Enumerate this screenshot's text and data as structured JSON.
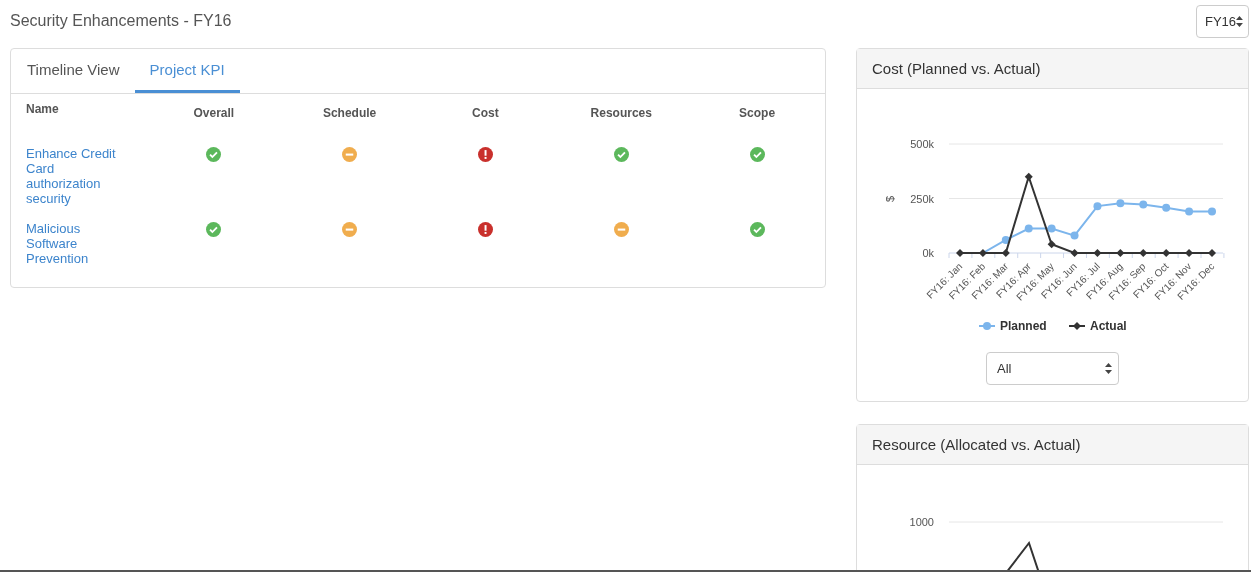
{
  "page_title": "Security Enhancements - FY16",
  "year_select": {
    "value": "FY16"
  },
  "tabs": [
    {
      "label": "Timeline View",
      "selected": false
    },
    {
      "label": "Project KPI",
      "selected": true
    }
  ],
  "kpi_table": {
    "columns": [
      "Name",
      "Overall",
      "Schedule",
      "Cost",
      "Resources",
      "Scope"
    ],
    "rows": [
      {
        "name": "Enhance Credit Card authorization security",
        "statuses": [
          {
            "kind": "ok"
          },
          {
            "kind": "warning"
          },
          {
            "kind": "error"
          },
          {
            "kind": "ok"
          },
          {
            "kind": "ok"
          }
        ]
      },
      {
        "name": "Malicious Software Prevention",
        "statuses": [
          {
            "kind": "ok"
          },
          {
            "kind": "warning"
          },
          {
            "kind": "error"
          },
          {
            "kind": "warning"
          },
          {
            "kind": "ok"
          }
        ]
      }
    ]
  },
  "cost_panel": {
    "title": "Cost (Planned vs. Actual)",
    "chart_data": {
      "type": "line",
      "ylabel": "$",
      "categories": [
        "FY16: Jan",
        "FY16: Feb",
        "FY16: Mar",
        "FY16: Apr",
        "FY16: May",
        "FY16: Jun",
        "FY16: Jul",
        "FY16: Aug",
        "FY16: Sep",
        "FY16: Oct",
        "FY16: Nov",
        "FY16: Dec"
      ],
      "legend": true,
      "series": [
        {
          "name": "Planned",
          "color": "#7cb5ec",
          "marker": "circle",
          "values": [
            0,
            0,
            60000,
            112000,
            112000,
            80000,
            215000,
            228000,
            222000,
            208000,
            190000,
            190000
          ]
        },
        {
          "name": "Actual",
          "color": "#333333",
          "marker": "diamond",
          "values": [
            0,
            0,
            0,
            350000,
            40000,
            0,
            0,
            0,
            0,
            0,
            0,
            0
          ]
        }
      ],
      "ylim": [
        0,
        500000
      ],
      "yticks": [
        {
          "value": 0,
          "label": "0k"
        },
        {
          "value": 250000,
          "label": "250k"
        },
        {
          "value": 500000,
          "label": "500k"
        }
      ]
    },
    "filter_select": {
      "value": "All"
    }
  },
  "resource_panel": {
    "title": "Resource (Allocated vs. Actual)",
    "tick_labels": [
      "1000"
    ]
  }
}
